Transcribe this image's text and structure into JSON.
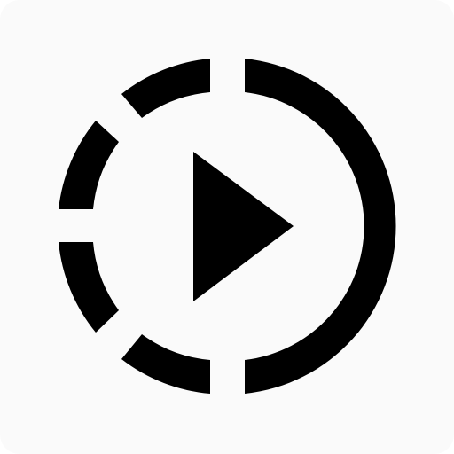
{
  "icon": {
    "name": "slow-motion-video-icon",
    "color": "#000000",
    "background": "#fafafa"
  }
}
